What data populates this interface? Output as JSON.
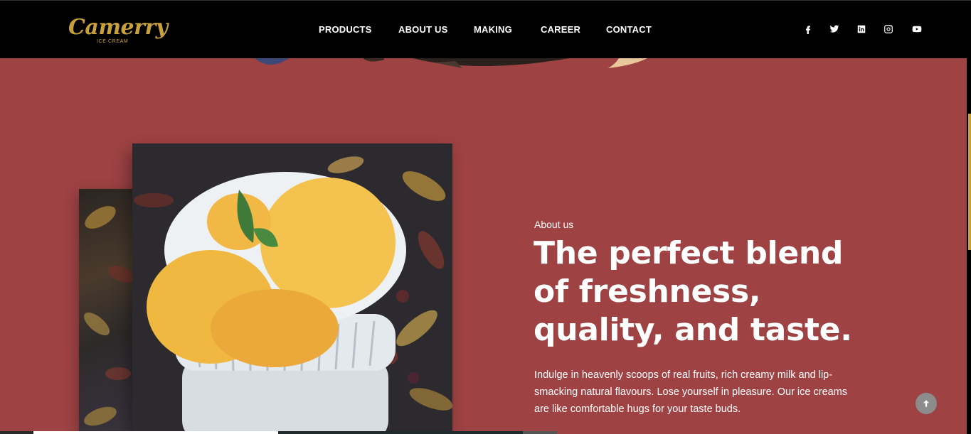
{
  "brand": {
    "name": "Camerry",
    "tagline": "ICE CREAM",
    "color": "#c9a13a"
  },
  "nav": {
    "items": [
      {
        "label": "PRODUCTS"
      },
      {
        "label": "ABOUT US"
      },
      {
        "label": "MAKING"
      },
      {
        "label": "CAREER"
      },
      {
        "label": "CONTACT"
      }
    ]
  },
  "social": [
    {
      "icon": "facebook-icon"
    },
    {
      "icon": "twitter-icon"
    },
    {
      "icon": "linkedin-icon"
    },
    {
      "icon": "instagram-icon"
    },
    {
      "icon": "youtube-icon"
    }
  ],
  "about": {
    "kicker": "About us",
    "headline_line1": "The perfect blend",
    "headline_line2": "of freshness,",
    "headline_line3": "quality, and taste.",
    "body": "Indulge in heavenly scoops of real fruits, rich creamy milk and lip-smacking natural flavours. Lose yourself in pleasure. Our ice creams are like comfortable hugs for your taste buds."
  },
  "colors": {
    "background": "#9e4244",
    "header": "#000000",
    "accent": "#c9a13a"
  },
  "scroll_top": {
    "icon": "arrow-up-icon"
  }
}
